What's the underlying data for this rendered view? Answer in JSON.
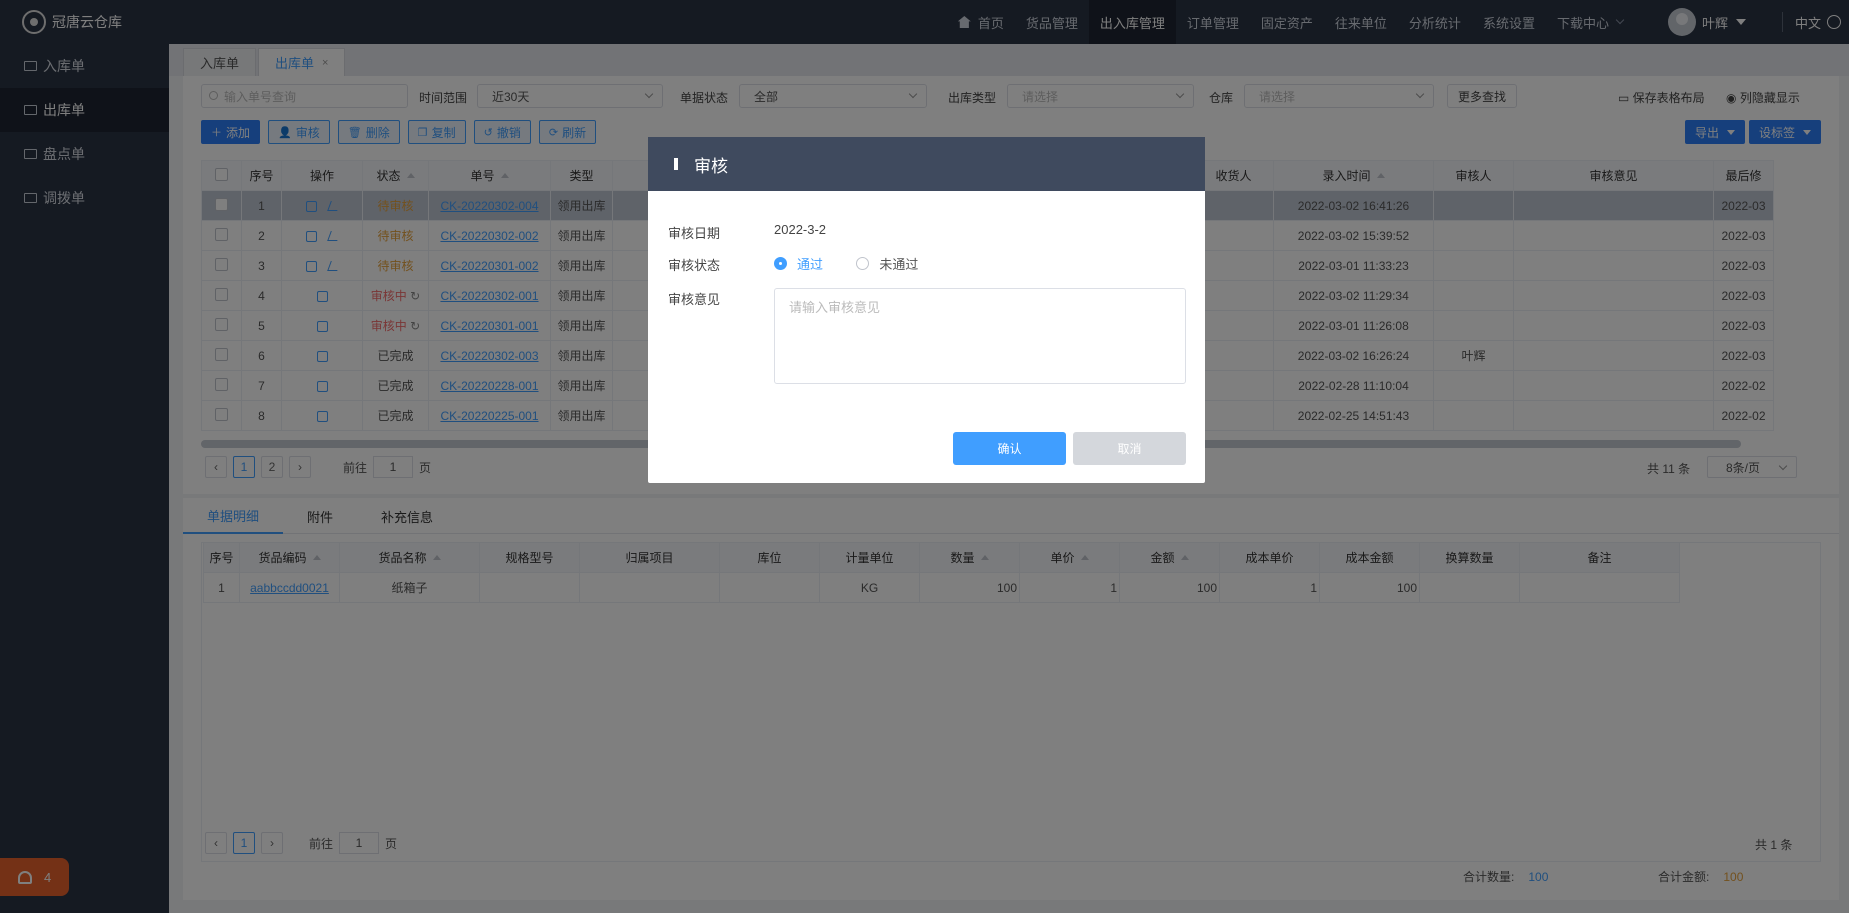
{
  "app": {
    "name": "冠唐云仓库"
  },
  "sidebar": {
    "items": [
      {
        "label": "入库单",
        "active": false
      },
      {
        "label": "出库单",
        "active": true
      },
      {
        "label": "盘点单",
        "active": false
      },
      {
        "label": "调拨单",
        "active": false
      }
    ],
    "alert_count": "4"
  },
  "topnav": {
    "items": [
      "首页",
      "货品管理",
      "出入库管理",
      "订单管理",
      "固定资产",
      "往来单位",
      "分析统计",
      "系统设置",
      "下载中心"
    ],
    "active": "出入库管理",
    "user": "叶辉",
    "lang": "中文"
  },
  "pagetabs": [
    {
      "label": "入库单"
    },
    {
      "label": "出库单",
      "close": "×"
    }
  ],
  "filters": {
    "search_placeholder": "输入单号查询",
    "time_label": "时间范围",
    "time_value": "近30天",
    "status_label": "单据状态",
    "status_value": "全部",
    "type_label": "出库类型",
    "type_placeholder": "请选择",
    "warehouse_label": "仓库",
    "warehouse_placeholder": "请选择",
    "more": "更多查找",
    "save_layout": "保存表格布局",
    "column_toggle": "列隐藏显示"
  },
  "toolbar": {
    "add": "添加",
    "audit": "审核",
    "delete": "删除",
    "copy": "复制",
    "revoke": "撤销",
    "refresh": "刷新",
    "export": "导出",
    "tags": "设标签"
  },
  "table": {
    "headers": [
      "序号",
      "操作",
      "状态",
      "单号",
      "类型",
      "收货人",
      "录入时间",
      "审核人",
      "审核意见",
      "最后修"
    ],
    "rows": [
      {
        "no": "1",
        "status": "待审核",
        "code": "CK-20220302-004",
        "type": "领用出库",
        "time": "2022-03-02 16:41:26",
        "auditor": "",
        "last": "2022-03"
      },
      {
        "no": "2",
        "status": "待审核",
        "code": "CK-20220302-002",
        "type": "领用出库",
        "time": "2022-03-02 15:39:52",
        "auditor": "",
        "last": "2022-03"
      },
      {
        "no": "3",
        "status": "待审核",
        "code": "CK-20220301-002",
        "type": "领用出库",
        "time": "2022-03-01 11:33:23",
        "auditor": "",
        "last": "2022-03"
      },
      {
        "no": "4",
        "status": "审核中",
        "code": "CK-20220302-001",
        "type": "领用出库",
        "time": "2022-03-02 11:29:34",
        "auditor": "",
        "last": "2022-03"
      },
      {
        "no": "5",
        "status": "审核中",
        "code": "CK-20220301-001",
        "type": "领用出库",
        "time": "2022-03-01 11:26:08",
        "auditor": "",
        "last": "2022-03"
      },
      {
        "no": "6",
        "status": "已完成",
        "code": "CK-20220302-003",
        "type": "领用出库",
        "time": "2022-03-02 16:26:24",
        "auditor": "叶辉",
        "last": "2022-03"
      },
      {
        "no": "7",
        "status": "已完成",
        "code": "CK-20220228-001",
        "type": "领用出库",
        "time": "2022-02-28 11:10:04",
        "auditor": "",
        "last": "2022-02"
      },
      {
        "no": "8",
        "status": "已完成",
        "code": "CK-20220225-001",
        "type": "领用出库",
        "time": "2022-02-25 14:51:43",
        "auditor": "",
        "last": "2022-02"
      }
    ]
  },
  "pager": {
    "pages": [
      "1",
      "2"
    ],
    "goto_prefix": "前往",
    "goto_value": "1",
    "goto_suffix": "页",
    "total": "共 11 条",
    "page_size": "8条/页"
  },
  "detail": {
    "tabs": [
      "单据明细",
      "附件",
      "补充信息"
    ],
    "headers": [
      "序号",
      "货品编码",
      "货品名称",
      "规格型号",
      "归属项目",
      "库位",
      "计量单位",
      "数量",
      "单价",
      "金额",
      "成本单价",
      "成本金额",
      "换算数量",
      "备注"
    ],
    "rows": [
      {
        "no": "1",
        "code": "aabbccdd0021",
        "name": "纸箱子",
        "spec": "",
        "project": "",
        "loc": "",
        "unit": "KG",
        "qty": "100",
        "price": "1",
        "amount": "100",
        "cost_price": "1",
        "cost_amount": "100",
        "conv": "",
        "note": ""
      }
    ],
    "pager": {
      "page": "1",
      "goto_prefix": "前往",
      "goto_value": "1",
      "goto_suffix": "页",
      "total": "共 1 条"
    },
    "sum_qty_label": "合计数量:",
    "sum_qty": "100",
    "sum_amount_label": "合计金额:",
    "sum_amount": "100"
  },
  "modal": {
    "title": "审核",
    "date_label": "审核日期",
    "date_value": "2022-3-2",
    "status_label": "审核状态",
    "option_pass": "通过",
    "option_fail": "未通过",
    "opinion_label": "审核意见",
    "opinion_placeholder": "请输入审核意见",
    "confirm": "确认",
    "cancel": "取消"
  }
}
